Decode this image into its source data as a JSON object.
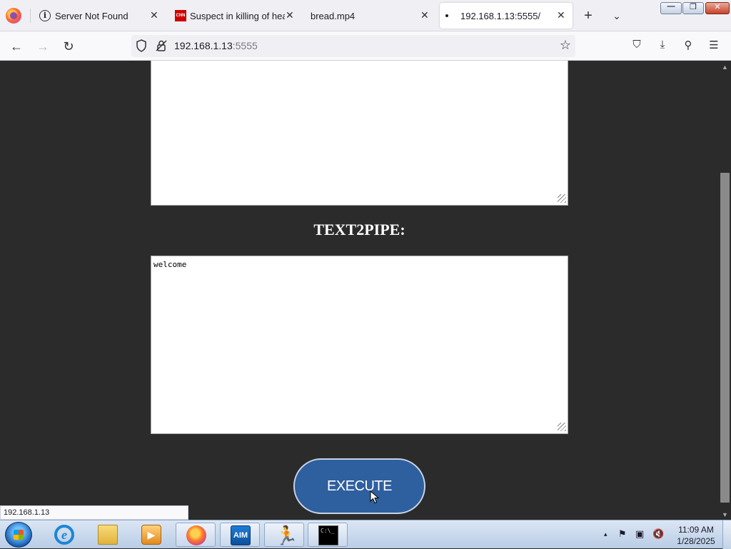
{
  "browser": {
    "tabs": [
      {
        "title": "Server Not Found",
        "close": "✕"
      },
      {
        "title": "Suspect in killing of heal",
        "close": "✕"
      },
      {
        "title": "bread.mp4",
        "close": "✕"
      },
      {
        "title": "192.168.1.13:5555/",
        "close": "✕",
        "active": true
      }
    ],
    "new_tab": "+",
    "tab_list": "⌄",
    "nav": {
      "back": "←",
      "forward": "→",
      "reload": "↻"
    },
    "url": {
      "host": "192.168.1.13",
      "port": ":5555"
    },
    "bookmark_star": "☆",
    "toolbar_right": {
      "pocket": "⛉",
      "downloads": "⤓",
      "extensions": "⚲",
      "menu": "☰"
    },
    "window_controls": {
      "minimize": "—",
      "maximize": "❐",
      "close": "✕"
    },
    "status_link": "192.168.1.13"
  },
  "page": {
    "top_textarea_value": "",
    "section_title": "TEXT2PIPE:",
    "text2pipe_value": "welcome",
    "execute_label": "EXECUTE",
    "accent_color": "#2e5f9e",
    "background_color": "#2b2b2b"
  },
  "taskbar": {
    "pinned": [
      "start-button",
      "internet-explorer",
      "windows-explorer",
      "media-center",
      "firefox",
      "aim",
      "aim-runner",
      "command-prompt"
    ],
    "aim_label": "AIM",
    "cmd_label": "C:\\_",
    "tray": {
      "arrow": "▴",
      "flag": "⚑",
      "network": "▣",
      "volume": "🔇"
    },
    "clock_time": "11:09 AM",
    "clock_date": "1/28/2025"
  }
}
